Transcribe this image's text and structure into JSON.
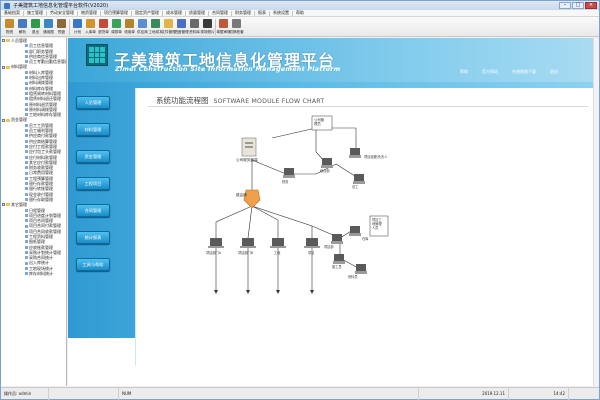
{
  "window": {
    "title": "子美建筑工地信息化管理平台软件(V2020)"
  },
  "menu": [
    "基础档案",
    "施工管理",
    "劳动安全管理",
    "物资管理",
    "项目预算管理",
    "固定资产管理",
    "成本管理",
    "质量管理",
    "合同管理",
    "财务管理",
    "报表",
    "系统设置",
    "帮助"
  ],
  "toolbar": [
    {
      "label": "物资",
      "icon": "box-icon",
      "color": "#c98a2b"
    },
    {
      "label": "解析",
      "icon": "chart-icon",
      "color": "#4a7bc0"
    },
    {
      "label": "退出",
      "icon": "exit-icon",
      "color": "#2e9b4a"
    },
    {
      "label": "通用图",
      "icon": "picture-icon",
      "color": "#3b88c5"
    },
    {
      "label": "预盘",
      "icon": "disk-icon",
      "color": "#8c6a3a"
    },
    {
      "label": "计划",
      "icon": "calendar-icon",
      "color": "#3a76c4"
    },
    {
      "label": "入库单",
      "icon": "inbox-icon",
      "color": "#d2952e"
    },
    {
      "label": "退货单",
      "icon": "return-icon",
      "color": "#c44a3a"
    },
    {
      "label": "调拨单",
      "icon": "transfer-icon",
      "color": "#3aa35a"
    },
    {
      "label": "领用单",
      "icon": "receipt-icon",
      "color": "#b3852f"
    },
    {
      "label": "供应商",
      "icon": "supplier-icon",
      "color": "#5a8fd0"
    },
    {
      "label": "工地成本",
      "icon": "cost-icon",
      "color": "#3c8a5a"
    },
    {
      "label": "文件管理",
      "icon": "folder-icon",
      "color": "#e0b54a"
    },
    {
      "label": "进度管理",
      "icon": "progress-icon",
      "color": "#4b6fc1"
    },
    {
      "label": "资料库",
      "icon": "database-icon",
      "color": "#6a6a6a"
    },
    {
      "label": "现场照片",
      "icon": "camera-icon",
      "color": "#3a3a3a"
    },
    {
      "label": "单据审核",
      "icon": "audit-icon",
      "color": "#c0583a"
    },
    {
      "label": "切换账套",
      "icon": "switch-icon",
      "color": "#7a7a7a"
    }
  ],
  "tree": [
    {
      "level": 0,
      "type": "folder",
      "label": "人员管理"
    },
    {
      "level": 1,
      "type": "leaf",
      "label": "员工信息管理"
    },
    {
      "level": 1,
      "type": "leaf",
      "label": "部门职务管理"
    },
    {
      "level": 1,
      "type": "leaf",
      "label": "供应商信息管理"
    },
    {
      "level": 1,
      "type": "leaf",
      "label": "员工考勤出勤信息管理"
    },
    {
      "level": 0,
      "type": "folder",
      "label": "材料管理"
    },
    {
      "level": 1,
      "type": "leaf",
      "label": "材料入库管理"
    },
    {
      "level": 1,
      "type": "leaf",
      "label": "材料出库管理"
    },
    {
      "level": 1,
      "type": "leaf",
      "label": "材料调拨管理"
    },
    {
      "level": 1,
      "type": "leaf",
      "label": "材料库存管理"
    },
    {
      "level": 1,
      "type": "leaf",
      "label": "租赁周转材料管理"
    },
    {
      "level": 1,
      "type": "leaf",
      "label": "租赁材料退还管理"
    },
    {
      "level": 1,
      "type": "leaf",
      "label": "原材料退货管理"
    },
    {
      "level": 1,
      "type": "leaf",
      "label": "原材料调拨管理"
    },
    {
      "level": 1,
      "type": "leaf",
      "label": "工地材料库存管理"
    },
    {
      "level": 0,
      "type": "folder",
      "label": "资金管理"
    },
    {
      "level": 1,
      "type": "leaf",
      "label": "员工工资管理"
    },
    {
      "level": 1,
      "type": "leaf",
      "label": "员工福利管理"
    },
    {
      "level": 1,
      "type": "leaf",
      "label": "供应商付款管理"
    },
    {
      "level": 1,
      "type": "leaf",
      "label": "供应商结算管理"
    },
    {
      "level": 1,
      "type": "leaf",
      "label": "应付工程款管理"
    },
    {
      "level": 1,
      "type": "leaf",
      "label": "应付包工头款管理"
    },
    {
      "level": 1,
      "type": "leaf",
      "label": "应付材料款管理"
    },
    {
      "level": 1,
      "type": "leaf",
      "label": "其它应付款管理"
    },
    {
      "level": 1,
      "type": "leaf",
      "label": "财务收款管理"
    },
    {
      "level": 1,
      "type": "leaf",
      "label": "日常费用管理"
    },
    {
      "level": 1,
      "type": "leaf",
      "label": "工程预算管理"
    },
    {
      "level": 1,
      "type": "leaf",
      "label": "银行存款管理"
    },
    {
      "level": 1,
      "type": "leaf",
      "label": "银行转账管理"
    },
    {
      "level": 1,
      "type": "leaf",
      "label": "现金收付管理"
    },
    {
      "level": 1,
      "type": "leaf",
      "label": "银行存取管理"
    },
    {
      "level": 0,
      "type": "folder",
      "label": "其它管理"
    },
    {
      "level": 1,
      "type": "leaf",
      "label": "日程管理"
    },
    {
      "level": 1,
      "type": "leaf",
      "label": "项目进度计划管理"
    },
    {
      "level": 1,
      "type": "leaf",
      "label": "项目合同管理"
    },
    {
      "level": 1,
      "type": "leaf",
      "label": "项目合同付款管理"
    },
    {
      "level": 1,
      "type": "leaf",
      "label": "项目合同收款管理"
    },
    {
      "level": 1,
      "type": "leaf",
      "label": "工程资料管理"
    },
    {
      "level": 1,
      "type": "leaf",
      "label": "图纸管理"
    },
    {
      "level": 1,
      "type": "leaf",
      "label": "应收账款管理"
    },
    {
      "level": 1,
      "type": "leaf",
      "label": "采购计划统计管理"
    },
    {
      "level": 1,
      "type": "leaf",
      "label": "采购合同统计"
    },
    {
      "level": 1,
      "type": "leaf",
      "label": "出入库统计"
    },
    {
      "level": 1,
      "type": "leaf",
      "label": "工地现场统计"
    },
    {
      "level": 1,
      "type": "leaf",
      "label": "库存材料统计"
    }
  ],
  "header": {
    "title": "子美建筑工地信息化管理平台",
    "subtitle": "Zimei Construction Site Information Management Platform",
    "links": [
      "帮助",
      "官方网站",
      "在线视频下载",
      "退出"
    ]
  },
  "nav_buttons": [
    "人员管理",
    "材料管理",
    "资金管理",
    "工程项目",
    "合同管理",
    "统计报表",
    "工具与帮助"
  ],
  "panel": {
    "title_cn": "系统功能流程图",
    "title_en": "SOFTWARE MODULE FLOW CHART"
  },
  "flow_labels": {
    "server": "公司服务器端",
    "router": "路由器",
    "admin_box": "公司管\n理员",
    "pc_a": "财务",
    "pc_b": "综合部",
    "pc_c": "项目经理/负责人",
    "pc_d": "总工",
    "left_1": "项目部门A",
    "left_2": "项目部门B",
    "mid_1": "工地",
    "mid_2": "项目",
    "right_box": "项目工\n地管理\n人员",
    "site_a": "项目部",
    "site_b": "仓库",
    "site_c": "施工员",
    "site_d": "资料员"
  },
  "status": {
    "operator_label": "操作员:",
    "operator": "admin",
    "middle": "NUM",
    "date": "2019.12.11",
    "time": "14:42"
  }
}
